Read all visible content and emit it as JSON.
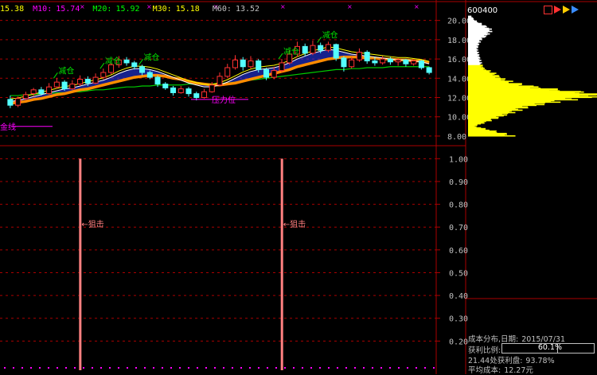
{
  "ma_legend": [
    {
      "name": "",
      "value": "15.38",
      "color": "#ffff00"
    },
    {
      "name": "M10:",
      "value": "15.74",
      "color": "#ff00ff"
    },
    {
      "name": "M20:",
      "value": "15.92",
      "color": "#00ff00"
    },
    {
      "name": "M30:",
      "value": "15.18",
      "color": "#ffff00"
    },
    {
      "name": "M60:",
      "value": "13.52",
      "color": "#c0c0c0"
    }
  ],
  "stock_code": "600400",
  "price_axis": [
    "20.00",
    "18.00",
    "16.00",
    "14.00",
    "12.00",
    "10.00",
    "8.00"
  ],
  "indicator_axis": [
    "1.00",
    "0.90",
    "0.80",
    "0.70",
    "0.60",
    "0.50",
    "0.40",
    "0.30",
    "0.20"
  ],
  "signals": {
    "reduce_1": "减仓",
    "reduce_2": "减仓",
    "reduce_3": "减仓",
    "reduce_4": "减仓",
    "reduce_5": "减仓",
    "gold_line": "金线",
    "resistance": "压力位",
    "snipe_1": "←狙击",
    "snipe_2": "←狙击"
  },
  "cost_panel": {
    "title": "成本分布,日期:",
    "date": "2015/07/31",
    "profit_ratio_label": "获利比例:",
    "profit_ratio_value": "60.1%",
    "profit_ratio": 0.601,
    "profit_at_label": "21.44处获利盘:",
    "profit_at_value": "93.78%",
    "avg_cost_label": "平均成本:",
    "avg_cost_value": "12.27元"
  },
  "colors": {
    "up": "#ff3232",
    "down": "#54ffff",
    "grid": "#aa0000",
    "snipe_bar": "#ff8080",
    "signal_green": "#00e000",
    "signal_magenta": "#ff00ff",
    "ma_orange": "#ff8c00",
    "ma_blue": "#2a3cff",
    "chip_yellow": "#ffff00",
    "chip_white": "#ffffff"
  },
  "chart_data": {
    "type": "candlestick",
    "price_range": [
      7.0,
      20.8
    ],
    "indicator_range": [
      0.1,
      1.05
    ],
    "candles": [
      [
        11.8,
        11.2,
        12.2,
        10.9
      ],
      [
        11.2,
        11.9,
        12.1,
        11.0
      ],
      [
        11.9,
        12.3,
        12.6,
        11.7
      ],
      [
        12.4,
        12.8,
        13.0,
        12.1
      ],
      [
        12.8,
        12.4,
        13.1,
        12.2
      ],
      [
        12.4,
        13.1,
        13.5,
        12.3
      ],
      [
        13.1,
        13.6,
        14.0,
        12.9
      ],
      [
        13.6,
        12.9,
        13.8,
        12.7
      ],
      [
        12.9,
        13.4,
        13.8,
        12.8
      ],
      [
        13.4,
        13.9,
        14.3,
        13.2
      ],
      [
        13.9,
        13.5,
        14.2,
        13.2
      ],
      [
        13.5,
        14.1,
        14.5,
        13.4
      ],
      [
        14.1,
        14.6,
        15.0,
        13.9
      ],
      [
        14.6,
        15.4,
        15.7,
        14.4
      ],
      [
        15.4,
        15.9,
        16.3,
        15.1
      ],
      [
        15.9,
        15.6,
        16.2,
        15.3
      ],
      [
        15.6,
        15.2,
        15.8,
        14.9
      ],
      [
        15.2,
        14.6,
        15.4,
        14.3
      ],
      [
        14.6,
        14.1,
        14.8,
        13.9
      ],
      [
        14.1,
        13.4,
        14.3,
        13.1
      ],
      [
        13.4,
        13.0,
        13.6,
        12.8
      ],
      [
        13.0,
        12.5,
        13.2,
        12.2
      ],
      [
        12.5,
        12.9,
        13.2,
        12.4
      ],
      [
        12.9,
        12.4,
        13.1,
        12.1
      ],
      [
        12.4,
        12.0,
        12.6,
        11.7
      ],
      [
        12.0,
        12.6,
        12.9,
        11.9
      ],
      [
        12.6,
        13.3,
        13.6,
        12.5
      ],
      [
        13.3,
        14.2,
        14.6,
        13.2
      ],
      [
        14.2,
        15.1,
        15.5,
        14.0
      ],
      [
        15.1,
        15.9,
        16.4,
        14.9
      ],
      [
        15.9,
        15.2,
        16.2,
        14.8
      ],
      [
        15.2,
        15.8,
        16.3,
        15.0
      ],
      [
        15.8,
        14.9,
        16.0,
        14.6
      ],
      [
        14.9,
        14.1,
        15.1,
        13.8
      ],
      [
        14.1,
        14.8,
        15.2,
        13.9
      ],
      [
        14.8,
        15.6,
        16.0,
        14.6
      ],
      [
        15.6,
        16.5,
        16.9,
        15.4
      ],
      [
        16.5,
        17.3,
        17.8,
        16.2
      ],
      [
        17.3,
        16.6,
        17.6,
        16.3
      ],
      [
        16.6,
        17.4,
        17.9,
        16.4
      ],
      [
        17.4,
        16.9,
        17.7,
        16.6
      ],
      [
        16.9,
        17.5,
        17.8,
        16.7
      ],
      [
        17.5,
        16.1,
        17.6,
        15.8
      ],
      [
        16.1,
        15.2,
        16.3,
        14.7
      ],
      [
        15.2,
        15.9,
        16.2,
        15.0
      ],
      [
        15.9,
        16.7,
        17.1,
        15.7
      ],
      [
        16.7,
        15.8,
        16.9,
        15.5
      ],
      [
        15.8,
        15.6,
        16.2,
        15.3
      ],
      [
        15.6,
        16.0,
        16.3,
        15.4
      ],
      [
        16.0,
        15.7,
        16.2,
        15.4
      ],
      [
        15.7,
        15.9,
        16.1,
        15.3
      ],
      [
        15.9,
        15.5,
        16.0,
        15.2
      ],
      [
        15.5,
        15.8,
        15.9,
        15.3
      ],
      [
        15.8,
        15.1,
        15.9,
        14.9
      ],
      [
        15.1,
        14.6,
        15.2,
        14.4
      ]
    ],
    "ma_fast": [
      11.6,
      11.7,
      11.9,
      12.1,
      12.3,
      12.5,
      12.7,
      12.9,
      13.0,
      13.2,
      13.4,
      13.6,
      13.8,
      14.1,
      14.5,
      14.8,
      15.0,
      15.0,
      14.9,
      14.7,
      14.4,
      14.1,
      13.8,
      13.5,
      13.3,
      13.1,
      13.1,
      13.3,
      13.6,
      14.0,
      14.4,
      14.7,
      14.9,
      15.0,
      15.1,
      15.3,
      15.6,
      16.0,
      16.3,
      16.6,
      16.8,
      17.0,
      16.9,
      16.7,
      16.5,
      16.4,
      16.3,
      16.2,
      16.1,
      16.0,
      15.9,
      15.9,
      15.8,
      15.7,
      15.5
    ],
    "ma_mid": [
      11.4,
      11.5,
      11.6,
      11.8,
      11.9,
      12.1,
      12.3,
      12.4,
      12.6,
      12.8,
      12.9,
      13.1,
      13.3,
      13.5,
      13.7,
      13.9,
      14.1,
      14.2,
      14.3,
      14.3,
      14.2,
      14.0,
      13.9,
      13.7,
      13.5,
      13.4,
      13.3,
      13.3,
      13.4,
      13.5,
      13.7,
      13.9,
      14.1,
      14.3,
      14.5,
      14.7,
      14.9,
      15.2,
      15.4,
      15.6,
      15.8,
      16.0,
      16.1,
      16.2,
      16.2,
      16.2,
      16.1,
      16.1,
      16.0,
      16.0,
      15.9,
      15.9,
      15.8,
      15.8,
      15.6
    ],
    "ma_slow": [
      12.2,
      12.2,
      12.3,
      12.3,
      12.4,
      12.4,
      12.5,
      12.5,
      12.6,
      12.6,
      12.7,
      12.8,
      12.8,
      12.9,
      13.0,
      13.1,
      13.1,
      13.2,
      13.2,
      13.3,
      13.3,
      13.3,
      13.3,
      13.4,
      13.4,
      13.4,
      13.4,
      13.5,
      13.5,
      13.6,
      13.7,
      13.8,
      13.9,
      14.0,
      14.1,
      14.2,
      14.3,
      14.4,
      14.5,
      14.6,
      14.7,
      14.8,
      14.9,
      14.9,
      15.0,
      15.0,
      15.1,
      15.1,
      15.1,
      15.2,
      15.2,
      15.2,
      15.2,
      15.2,
      15.2
    ],
    "snipe_signals": [
      {
        "index": 10,
        "value": 1.0
      },
      {
        "index": 36,
        "value": 1.0
      }
    ],
    "chip_distribution": {
      "price_levels": [
        8.0,
        8.5,
        9.0,
        9.5,
        10.0,
        10.5,
        11.0,
        11.5,
        12.0,
        12.3,
        12.6,
        13.0,
        13.5,
        14.0,
        14.5,
        15.0,
        15.5,
        16.0,
        16.5,
        17.0,
        17.5,
        18.0,
        18.5,
        19.0,
        19.5,
        20.0,
        20.5
      ],
      "weights": [
        0.35,
        0.2,
        0.05,
        0.15,
        0.25,
        0.35,
        0.45,
        0.65,
        0.9,
        1.0,
        0.8,
        0.55,
        0.35,
        0.25,
        0.2,
        0.12,
        0.1,
        0.09,
        0.08,
        0.07,
        0.08,
        0.1,
        0.15,
        0.18,
        0.12,
        0.05,
        0.02
      ],
      "profit_below_price": 15.38
    }
  }
}
